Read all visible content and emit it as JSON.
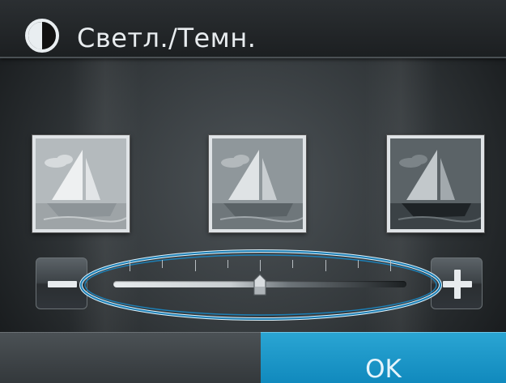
{
  "header": {
    "title": "Светл./Темн.",
    "icon": "contrast-icon"
  },
  "thumbnails": [
    {
      "name": "lighter",
      "icon": "sailboat-icon"
    },
    {
      "name": "current",
      "icon": "sailboat-icon"
    },
    {
      "name": "darker",
      "icon": "sailboat-icon"
    }
  ],
  "slider": {
    "value_fraction": 0.5,
    "tick_count": 9,
    "minus_icon": "minus-icon",
    "plus_icon": "plus-icon"
  },
  "footer": {
    "ok_label": "OK"
  },
  "colors": {
    "accent": "#1a97c8",
    "highlight_ellipse": "#1d7fb5"
  }
}
